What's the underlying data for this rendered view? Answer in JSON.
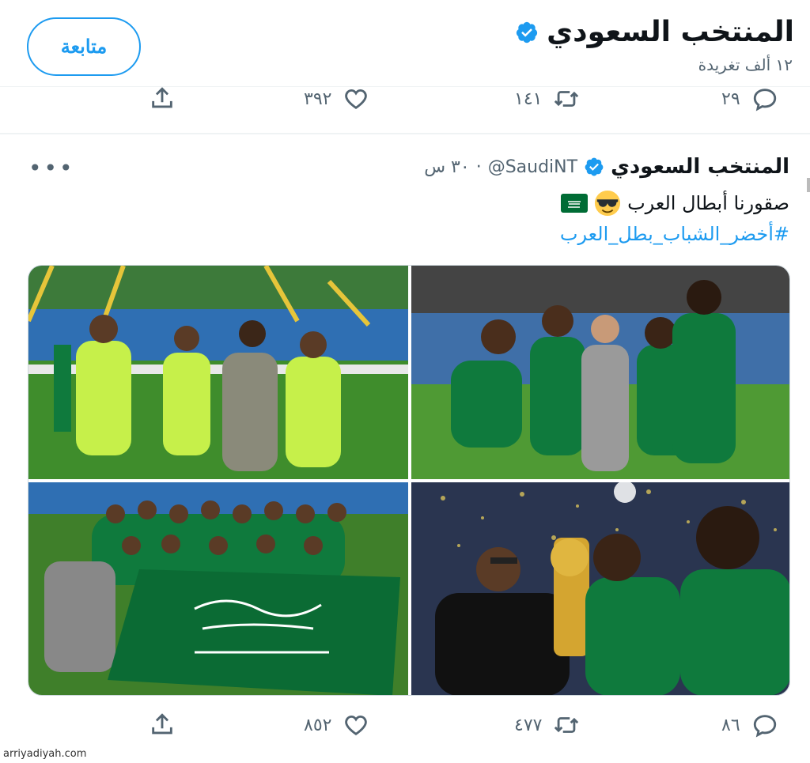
{
  "header": {
    "account_name": "المنتخب السعودي",
    "tweet_count": "١٢ ألف تغريدة",
    "follow_label": "متابعة"
  },
  "prev_tweet_actions": {
    "reply_count": "٢٩",
    "retweet_count": "١٤١",
    "like_count": "٣٩٢"
  },
  "tweet": {
    "author_name": "المنتخب السعودي",
    "handle": "@SaudiNT",
    "separator": "·",
    "time": "٣٠ س",
    "text": "صقورنا أبطال العرب",
    "hashtag": "#أخضر_الشباب_بطل_العرب",
    "emojis": [
      "smiling-face-with-sunglasses",
      "saudi-flag"
    ],
    "photos": [
      "team-celebration-goalkeepers",
      "players-posing-green-kits",
      "squad-with-saudi-flag",
      "trophy-celebration"
    ],
    "actions": {
      "reply_count": "٨٦",
      "retweet_count": "٤٧٧",
      "like_count": "٨٥٢"
    }
  },
  "icons": {
    "reply": "reply-icon",
    "retweet": "retweet-icon",
    "like": "heart-icon",
    "share": "share-icon",
    "verified": "verified-badge-icon",
    "more": "more-options-icon"
  },
  "colors": {
    "accent": "#1d9bf0",
    "muted": "#536471",
    "kit_green": "#0f7a3d",
    "keeper_yellow": "#c6f04a",
    "pitch": "#3d8a2a"
  },
  "watermark": "arriyadiyah.com"
}
